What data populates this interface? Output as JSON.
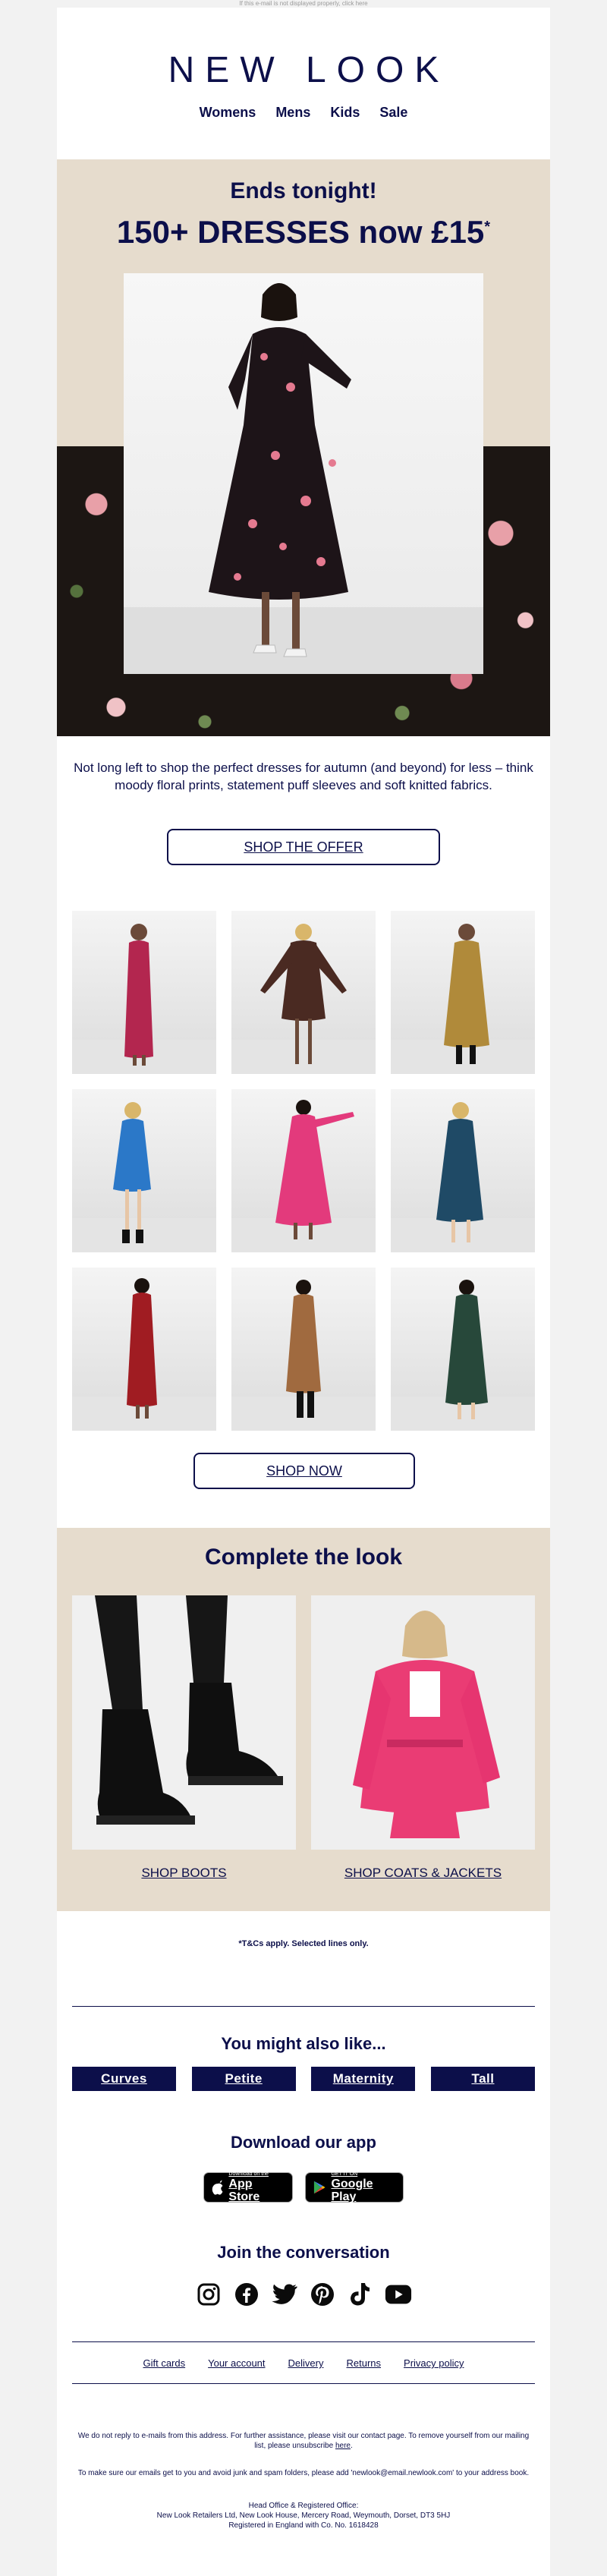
{
  "preheader": {
    "text": "If this e-mail is not displayed properly, click here"
  },
  "header": {
    "logo": "NEW LOOK",
    "nav": [
      "Womens",
      "Mens",
      "Kids",
      "Sale"
    ]
  },
  "hero": {
    "line1": "Ends tonight!",
    "line2": "150+ DRESSES now £15",
    "line2_mark": "*",
    "body": "Not long left to shop the perfect dresses for autumn (and beyond) for less – think moody floral prints, statement puff sleeves and soft knitted fabrics.",
    "cta": "SHOP THE OFFER"
  },
  "grid": {
    "tiles": [
      {
        "color": "#b3264f"
      },
      {
        "color": "#4a2a22"
      },
      {
        "color": "#b08a3a"
      },
      {
        "color": "#2b78c8"
      },
      {
        "color": "#e33a7c"
      },
      {
        "color": "#1f4a66"
      },
      {
        "color": "#a01c22"
      },
      {
        "color": "#a06a3f"
      },
      {
        "color": "#27483a"
      }
    ],
    "cta": "SHOP NOW"
  },
  "complete_look": {
    "title": "Complete the look",
    "left_link": "SHOP BOOTS",
    "right_link": "SHOP COATS & JACKETS"
  },
  "tcs": "*T&Cs apply. Selected lines only.",
  "also_like": {
    "title": "You might also like...",
    "pills": [
      "Curves",
      "Petite",
      "Maternity",
      "Tall"
    ]
  },
  "app": {
    "title": "Download our app",
    "apple_small": "Download on the",
    "apple_big": "App Store",
    "google_small": "GET IT ON",
    "google_big": "Google Play"
  },
  "social": {
    "title": "Join the conversation",
    "icons": [
      "instagram-icon",
      "facebook-icon",
      "twitter-icon",
      "pinterest-icon",
      "tiktok-icon",
      "youtube-icon"
    ]
  },
  "footer": {
    "links": [
      "Gift cards",
      "Your account",
      "Delivery",
      "Returns",
      "Privacy policy"
    ],
    "notice_a": "We do not reply to e-mails from this address. For further assistance, please visit our contact page. To remove yourself from our mailing list, please unsubscribe ",
    "notice_link": "here",
    "notice_end": ".",
    "safe_sender": "To make sure our emails get to you and avoid junk and spam folders, please add 'newlook@email.newlook.com' to your address book.",
    "office_1": "Head Office & Registered Office:",
    "office_2": "New Look Retailers Ltd, New Look House, Mercery Road, Weymouth, Dorset,  DT3 5HJ",
    "office_3": "Registered in England with Co. No. 1618428"
  },
  "colors": {
    "navy": "#0c0f4a",
    "beige": "#e6dccd"
  }
}
